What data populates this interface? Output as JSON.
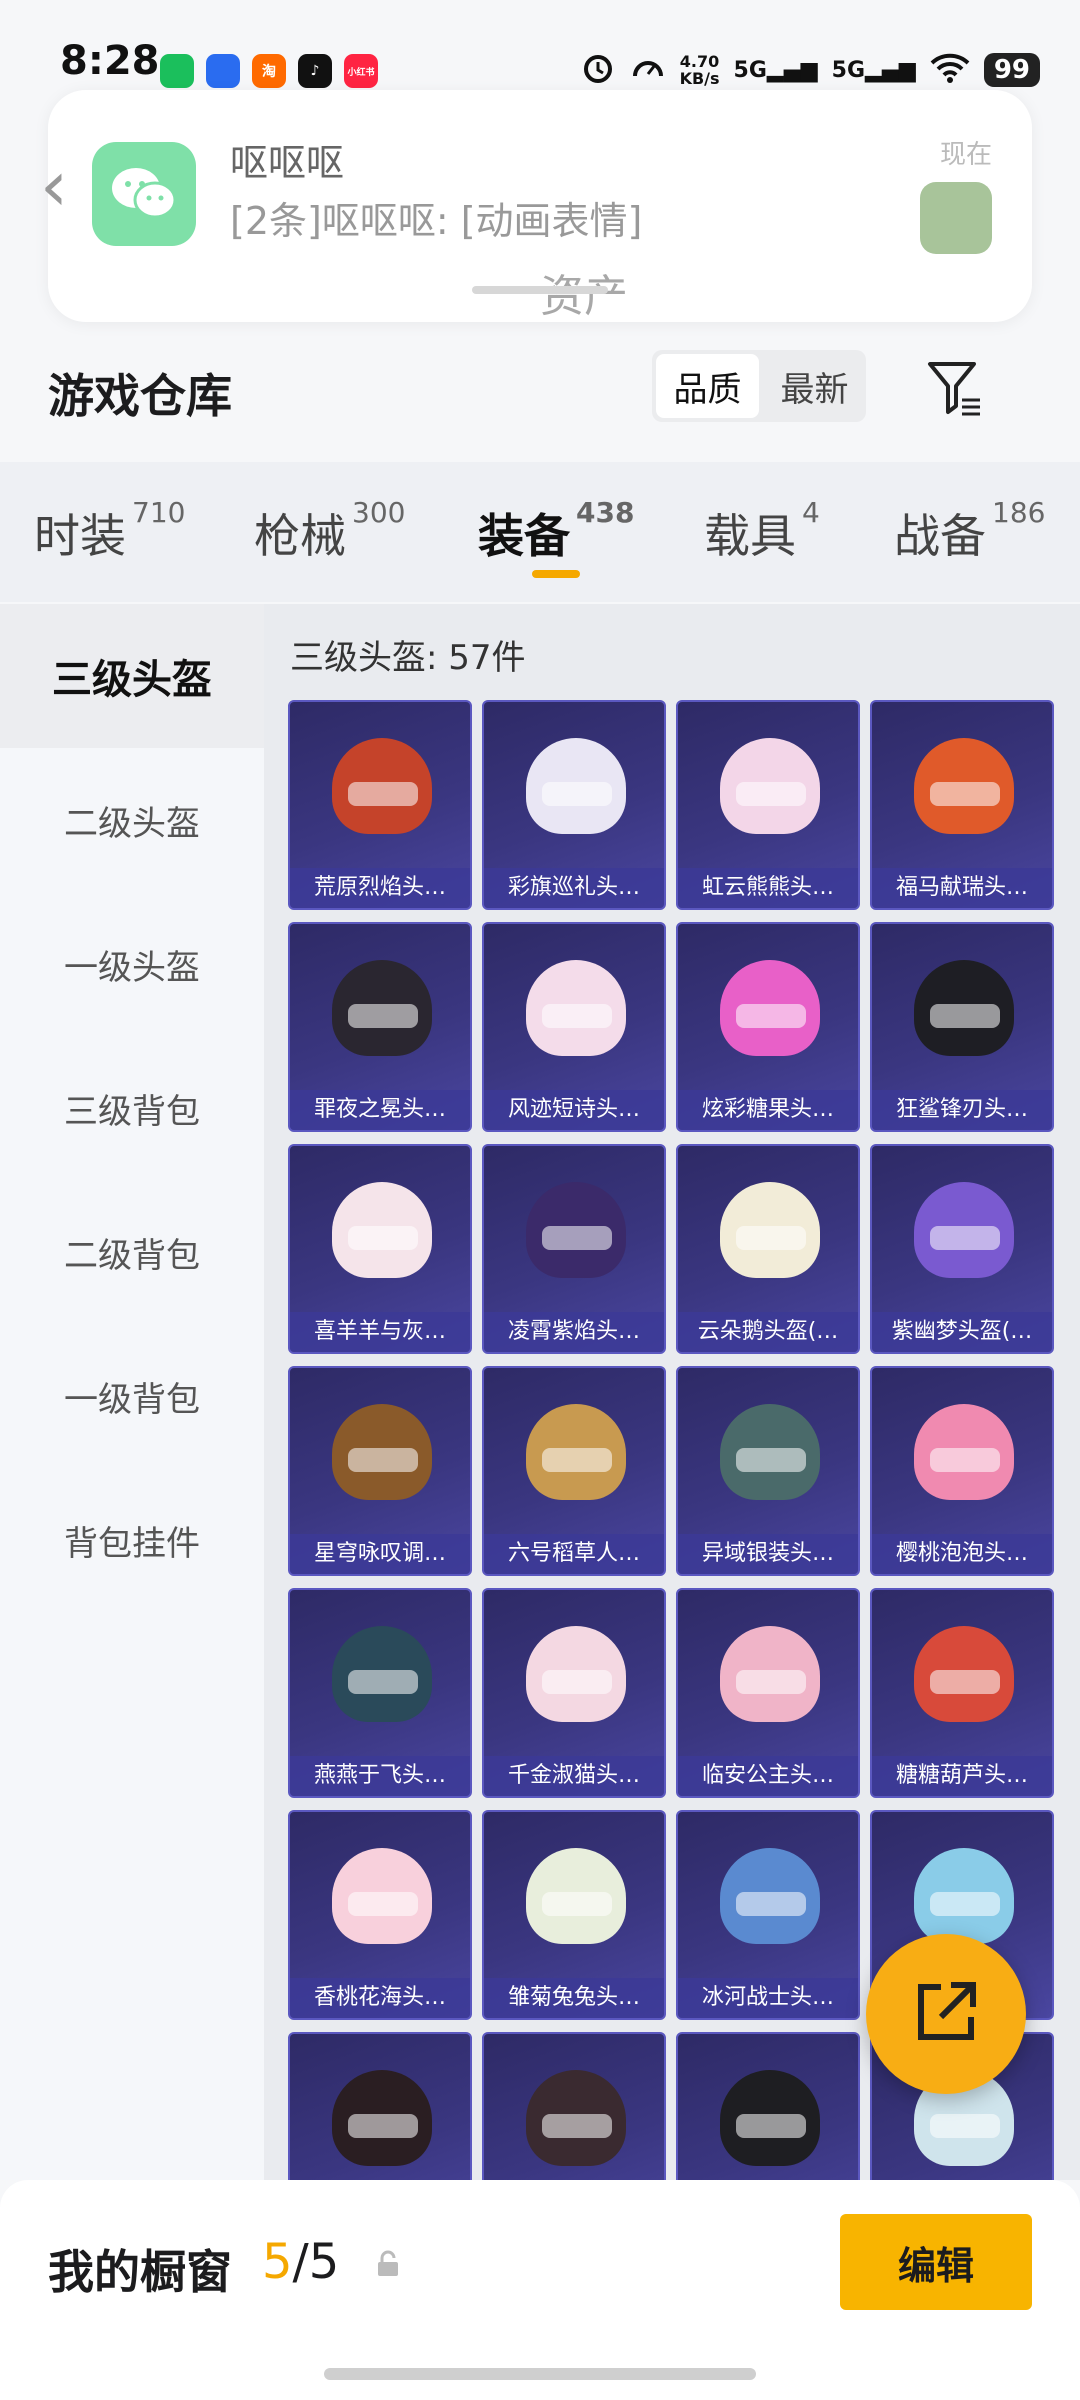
{
  "status": {
    "time": "8:28",
    "app_icons": [
      {
        "name": "wechat-app-icon",
        "label": "",
        "color": "#1bbf5c"
      },
      {
        "name": "browser-app-icon",
        "label": "",
        "color": "#2a6cf0"
      },
      {
        "name": "taobao-app-icon",
        "label": "淘",
        "color": "#ff6a00"
      },
      {
        "name": "tiktok-app-icon",
        "label": "♪",
        "color": "#111111"
      },
      {
        "name": "xiaohongshu-app-icon",
        "label": "小红书",
        "color": "#ff2442"
      }
    ],
    "net_speed_value": "4.70",
    "net_speed_unit": "KB/s",
    "signal_1": "5G",
    "signal_2": "5G",
    "battery": "99"
  },
  "notification": {
    "sender": "呕呕呕",
    "message": "[2条]呕呕呕: [动画表情]",
    "time": "现在",
    "ghost_title": "资产"
  },
  "header": {
    "title": "游戏仓库",
    "sort_options": [
      "品质",
      "最新"
    ]
  },
  "tabs": [
    {
      "label": "时装",
      "count": "710"
    },
    {
      "label": "枪械",
      "count": "300"
    },
    {
      "label": "装备",
      "count": "438"
    },
    {
      "label": "载具",
      "count": "4"
    },
    {
      "label": "战备",
      "count": "186"
    }
  ],
  "sidebar": [
    "三级头盔",
    "二级头盔",
    "一级头盔",
    "三级背包",
    "二级背包",
    "一级背包",
    "背包挂件"
  ],
  "content": {
    "section_title": "三级头盔: 57件",
    "items": [
      {
        "label": "荒原烈焰头…",
        "color": "#c5432a"
      },
      {
        "label": "彩旗巡礼头…",
        "color": "#e9e6f4"
      },
      {
        "label": "虹云熊熊头…",
        "color": "#f3d6e8"
      },
      {
        "label": "福马献瑞头…",
        "color": "#e05a2a"
      },
      {
        "label": "罪夜之冕头…",
        "color": "#2a2630"
      },
      {
        "label": "风迹短诗头…",
        "color": "#f4dcea"
      },
      {
        "label": "炫彩糖果头…",
        "color": "#e860c8"
      },
      {
        "label": "狂鲨锋刃头…",
        "color": "#1e1e24"
      },
      {
        "label": "喜羊羊与灰…",
        "color": "#f5e4ea"
      },
      {
        "label": "凌霄紫焰头…",
        "color": "#3b2a6a"
      },
      {
        "label": "云朵鹅头盔(…",
        "color": "#f2ecd8"
      },
      {
        "label": "紫幽梦头盔(…",
        "color": "#7a5ad0"
      },
      {
        "label": "星穹咏叹调…",
        "color": "#8a5a2a"
      },
      {
        "label": "六号稻草人…",
        "color": "#c89a50"
      },
      {
        "label": "异域银装头…",
        "color": "#4a6a6a"
      },
      {
        "label": "樱桃泡泡头…",
        "color": "#f08ab0"
      },
      {
        "label": "燕燕于飞头…",
        "color": "#2a4a5a"
      },
      {
        "label": "千金淑猫头…",
        "color": "#f4d8e2"
      },
      {
        "label": "临安公主头…",
        "color": "#f0b4c8"
      },
      {
        "label": "糖糖葫芦头…",
        "color": "#d84a3a"
      },
      {
        "label": "香桃花海头…",
        "color": "#f8d0dc"
      },
      {
        "label": "雏菊兔兔头…",
        "color": "#e8eedc"
      },
      {
        "label": "冰河战士头…",
        "color": "#5a8ad0"
      },
      {
        "label": "",
        "color": "#8acce8"
      },
      {
        "label": "",
        "color": "#2a1e22"
      },
      {
        "label": "",
        "color": "#3a2a30"
      },
      {
        "label": "",
        "color": "#1e1e22"
      },
      {
        "label": "",
        "color": "#cfe4ec"
      }
    ]
  },
  "bottom": {
    "showcase_label": "我的橱窗",
    "showcase_current": "5",
    "showcase_total": "/5",
    "edit_label": "编辑"
  },
  "colors": {
    "accent": "#f5a800",
    "card_bg": "#3a3680"
  }
}
